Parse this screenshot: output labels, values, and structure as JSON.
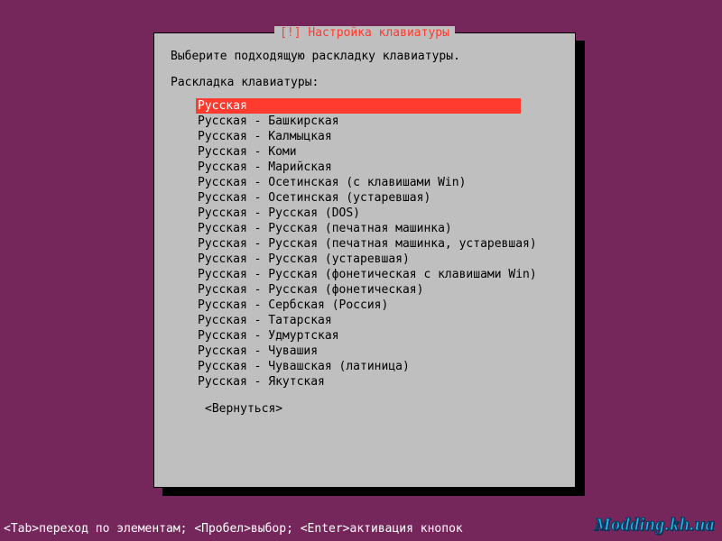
{
  "dialog": {
    "title": "[!] Настройка клавиатуры",
    "prompt": "Выберите подходящую раскладку клавиатуры.",
    "label": "Раскладка клавиатуры:",
    "back": "<Вернуться>"
  },
  "items": [
    "Русская",
    "Русская - Башкирская",
    "Русская - Калмыцкая",
    "Русская - Коми",
    "Русская - Марийская",
    "Русская - Осетинская (с клавишами Win)",
    "Русская - Осетинская (устаревшая)",
    "Русская - Русская (DOS)",
    "Русская - Русская (печатная машинка)",
    "Русская - Русская (печатная машинка, устаревшая)",
    "Русская - Русская (устаревшая)",
    "Русская - Русская (фонетическая с клавишами Win)",
    "Русская - Русская (фонетическая)",
    "Русская - Сербская (Россия)",
    "Русская - Татарская",
    "Русская - Удмуртская",
    "Русская - Чувашия",
    "Русская - Чувашская (латиница)",
    "Русская - Якутская"
  ],
  "selected_index": 0,
  "footer": "<Tab>переход по элементам; <Пробел>выбор; <Enter>активация кнопок",
  "watermark": "Modding.kh.ua"
}
